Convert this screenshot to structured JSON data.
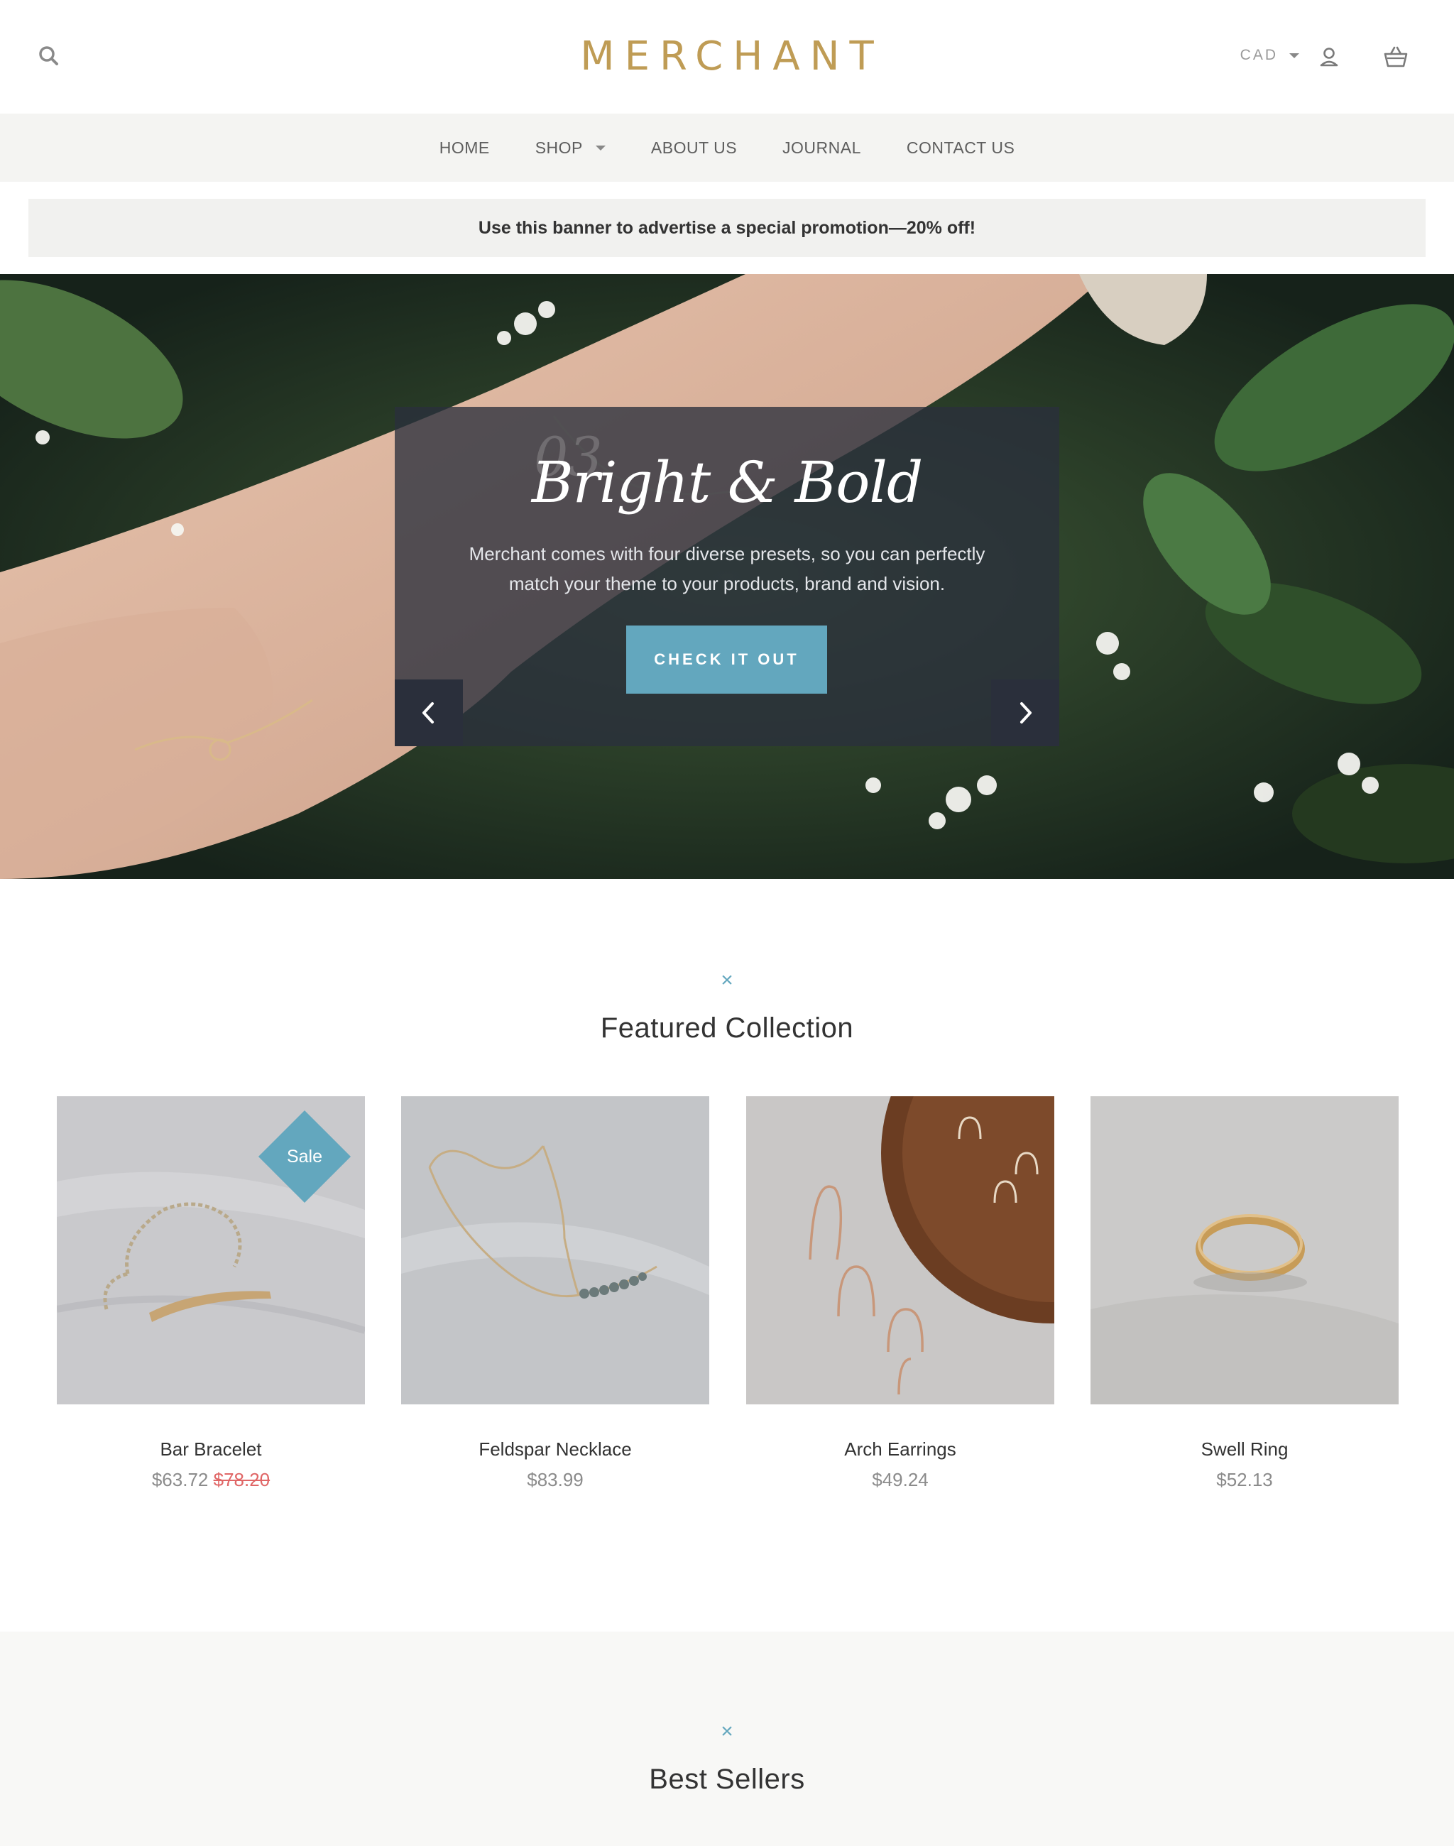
{
  "header": {
    "logo": "MERCHANT",
    "currency": "CAD"
  },
  "nav": {
    "items": [
      {
        "label": "HOME"
      },
      {
        "label": "SHOP"
      },
      {
        "label": "ABOUT US"
      },
      {
        "label": "JOURNAL"
      },
      {
        "label": "CONTACT US"
      }
    ]
  },
  "promo": {
    "text": "Use this banner to advertise a special promotion—20% off!"
  },
  "hero": {
    "slide_number": "03",
    "title": "Bright & Bold",
    "text": "Merchant comes with four diverse presets, so you can perfectly match your theme to your products, brand and vision.",
    "cta": "CHECK IT OUT"
  },
  "featured": {
    "title": "Featured Collection",
    "products": [
      {
        "name": "Bar Bracelet",
        "price": "$63.72",
        "old_price": "$78.20",
        "badge": "Sale"
      },
      {
        "name": "Feldspar Necklace",
        "price": "$83.99"
      },
      {
        "name": "Arch Earrings",
        "price": "$49.24"
      },
      {
        "name": "Swell Ring",
        "price": "$52.13"
      }
    ]
  },
  "bestsellers": {
    "title": "Best Sellers"
  },
  "icons": {
    "search": "search-icon",
    "account": "user-icon",
    "cart": "basket-icon",
    "divider": "cross-icon",
    "prev": "chevron-left-icon",
    "next": "chevron-right-icon"
  },
  "colors": {
    "brand_gold": "#bf9c55",
    "accent_blue": "#63a7be",
    "sale_red": "#e06666"
  }
}
